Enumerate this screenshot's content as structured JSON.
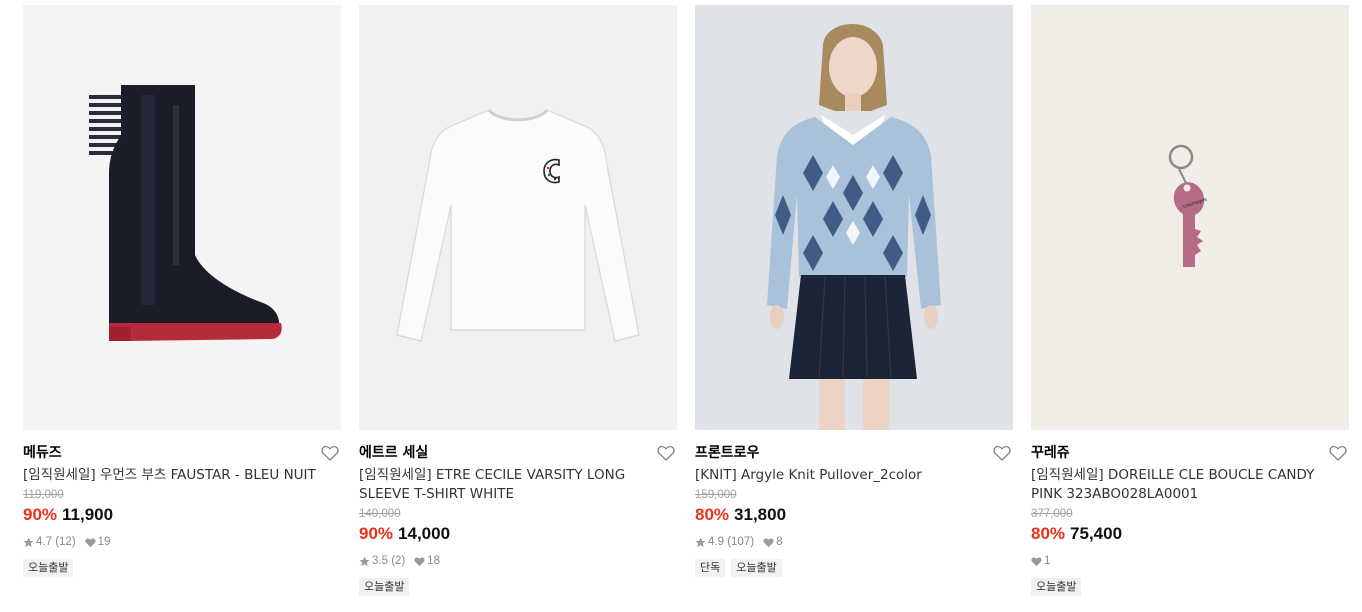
{
  "products": [
    {
      "brand": "메듀즈",
      "name": "[임직원세일] 우먼즈 부츠 FAUSTAR - BLEU NUIT",
      "original_price": "119,000",
      "discount_rate": "90%",
      "sale_price": "11,900",
      "rating": "4.7",
      "review_count": "(12)",
      "likes": "19",
      "tags": [
        "오늘출발"
      ],
      "image_icon": "rain-boot-image",
      "bg_color": "#f4f4f4"
    },
    {
      "brand": "에트르 세실",
      "name": "[임직원세일] ETRE CECILE VARSITY LONG SLEEVE T-SHIRT WHITE",
      "original_price": "140,000",
      "discount_rate": "90%",
      "sale_price": "14,000",
      "rating": "3.5",
      "review_count": "(2)",
      "likes": "18",
      "tags": [
        "오늘출발"
      ],
      "image_icon": "white-long-sleeve-tshirt-image",
      "bg_color": "#f1f1f1"
    },
    {
      "brand": "프론트로우",
      "name": "[KNIT] Argyle Knit Pullover_2color",
      "original_price": "159,000",
      "discount_rate": "80%",
      "sale_price": "31,800",
      "rating": "4.9",
      "review_count": "(107)",
      "likes": "8",
      "tags": [
        "단독",
        "오늘출발"
      ],
      "image_icon": "model-argyle-knit-image",
      "bg_color": "#dfe3e8"
    },
    {
      "brand": "꾸레쥬",
      "name": "[임직원세일] DOREILLE CLE BOUCLE CANDY PINK 323ABO028LA0001",
      "original_price": "377,000",
      "discount_rate": "80%",
      "sale_price": "75,400",
      "rating": "",
      "review_count": "",
      "likes": "1",
      "tags": [
        "오늘출발"
      ],
      "image_icon": "pink-key-earring-image",
      "bg_color": "#f0ede7"
    }
  ],
  "colors": {
    "discount": "#e8331b",
    "original_price": "#a0a0a0",
    "meta": "#8a8a8a",
    "tag_bg": "#f1f1f1"
  }
}
